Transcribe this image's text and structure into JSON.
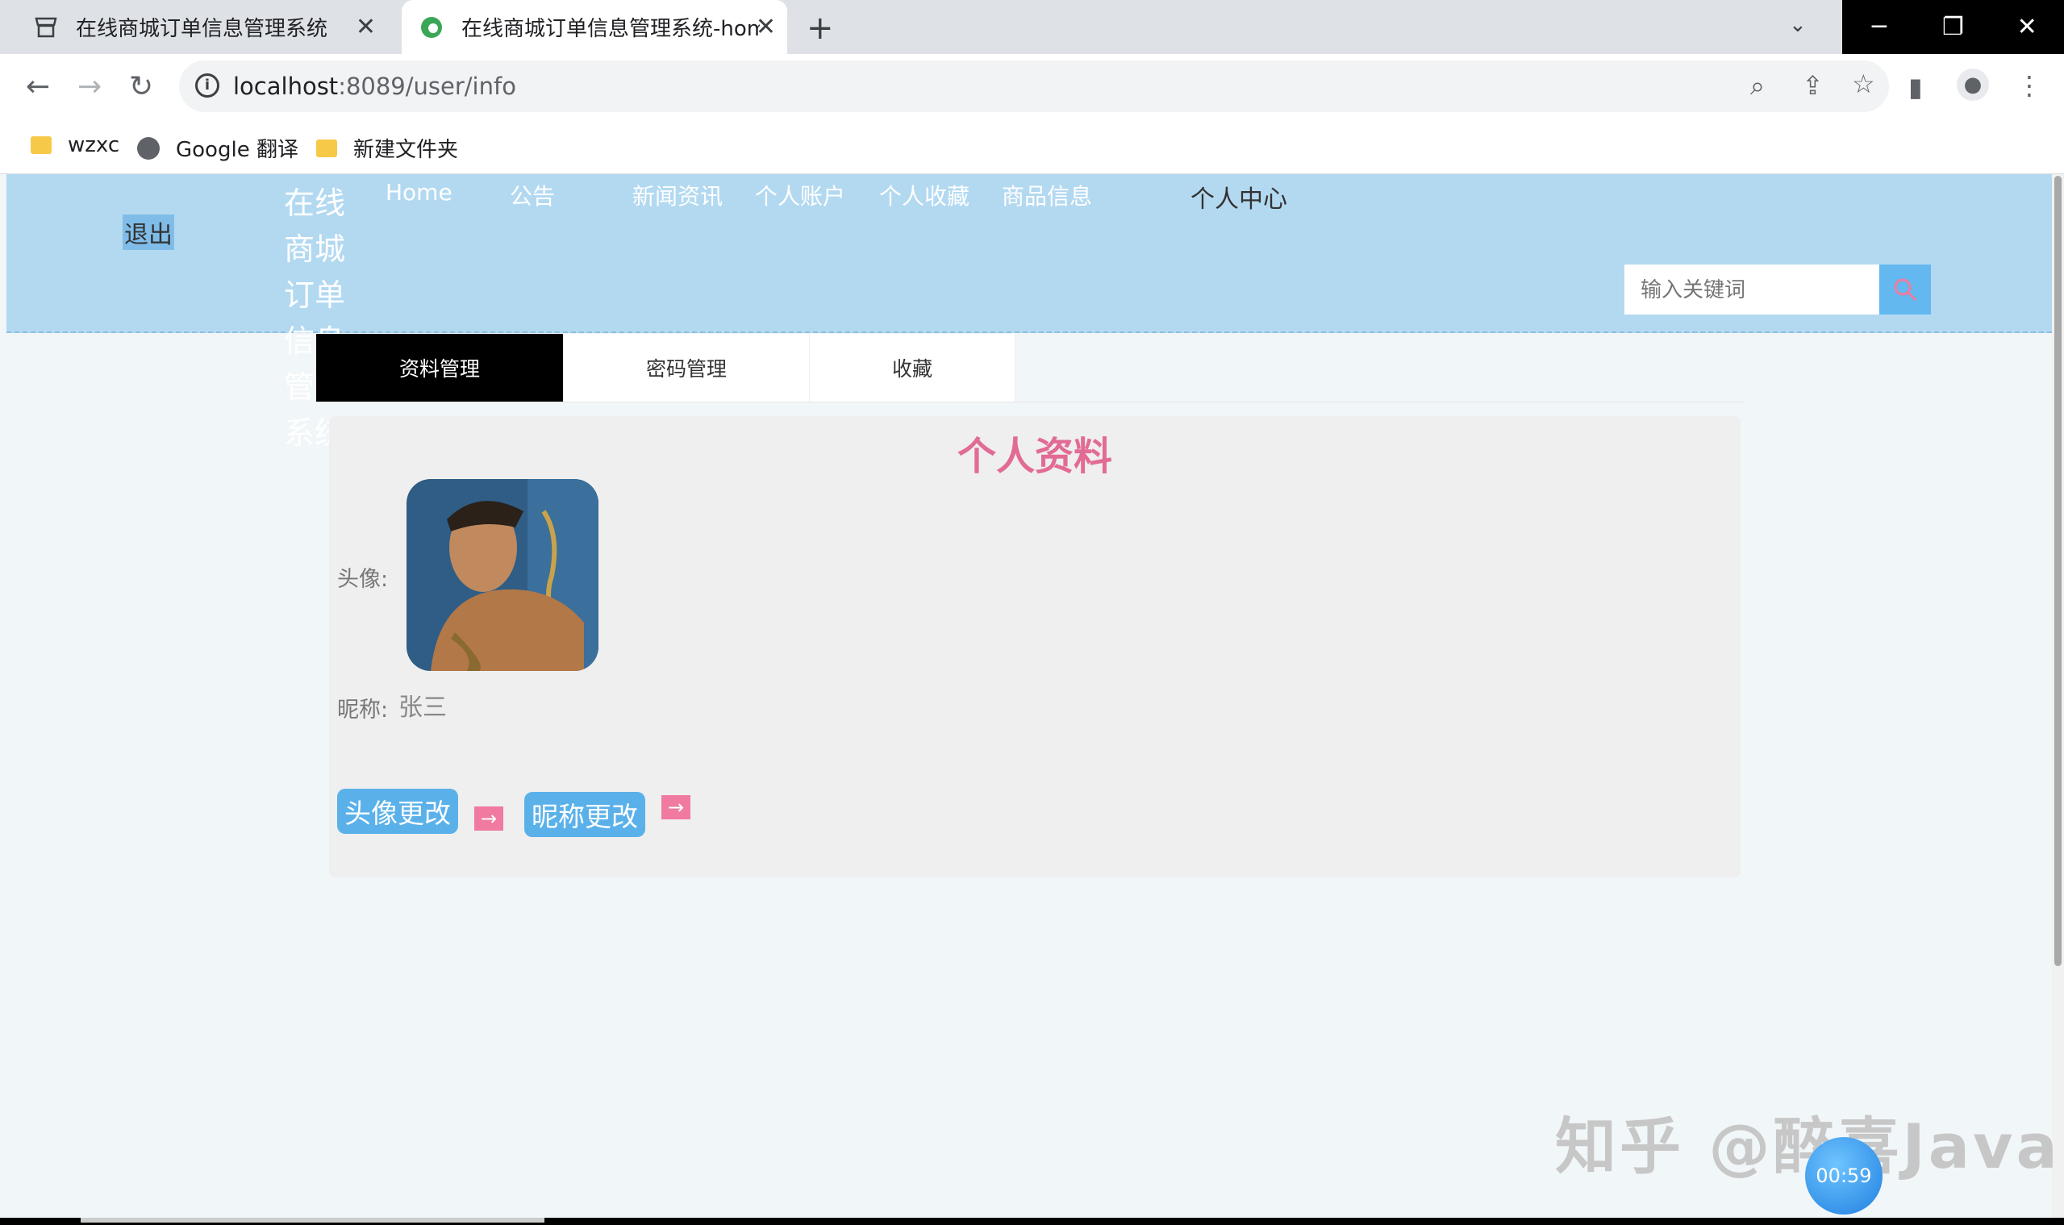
{
  "browser": {
    "tabs": [
      {
        "title": "在线商城订单信息管理系统"
      },
      {
        "title": "在线商城订单信息管理系统-hom"
      }
    ],
    "url_host": "localhost",
    "url_rest": ":8089/user/info",
    "bookmarks": [
      {
        "label": "wzxc",
        "icon": "folder-icon"
      },
      {
        "label": "Google 翻译",
        "icon": "globe-icon"
      },
      {
        "label": "新建文件夹",
        "icon": "folder-icon"
      }
    ]
  },
  "header": {
    "logout": "退出",
    "site_title_lines": [
      "在线",
      "商城",
      "订单",
      "信息",
      "管理",
      "系统"
    ],
    "nav": [
      "Home",
      "公告",
      "新闻资讯",
      "个人账户",
      "个人收藏",
      "商品信息",
      "个人中心"
    ],
    "search_placeholder": "输入关键词"
  },
  "profile_tabs": [
    "资料管理",
    "密码管理",
    "收藏"
  ],
  "profile": {
    "title": "个人资料",
    "avatar_label": "头像:",
    "nickname_label": "昵称:",
    "nickname_value": "张三",
    "change_avatar_button": "头像更改",
    "change_nickname_button": "昵称更改"
  },
  "overlay": {
    "watermark": "知乎 @醉喜Java",
    "timer": "00:59"
  },
  "colors": {
    "header_bg": "#b3d9f1",
    "accent_blue": "#5ab1ea",
    "title_pink": "#e26b95"
  }
}
